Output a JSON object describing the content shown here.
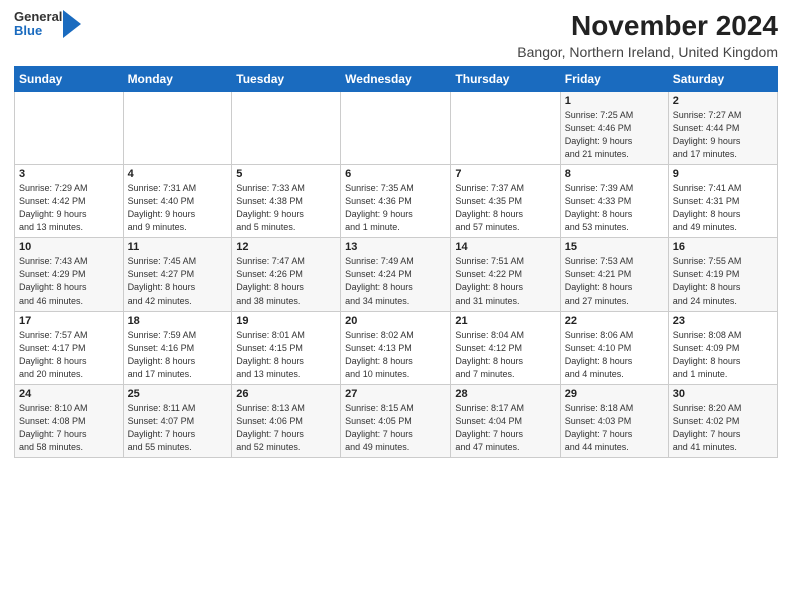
{
  "header": {
    "logo": {
      "general": "General",
      "blue": "Blue"
    },
    "title": "November 2024",
    "subtitle": "Bangor, Northern Ireland, United Kingdom"
  },
  "weekdays": [
    "Sunday",
    "Monday",
    "Tuesday",
    "Wednesday",
    "Thursday",
    "Friday",
    "Saturday"
  ],
  "weeks": [
    [
      {
        "day": "",
        "info": ""
      },
      {
        "day": "",
        "info": ""
      },
      {
        "day": "",
        "info": ""
      },
      {
        "day": "",
        "info": ""
      },
      {
        "day": "",
        "info": ""
      },
      {
        "day": "1",
        "info": "Sunrise: 7:25 AM\nSunset: 4:46 PM\nDaylight: 9 hours\nand 21 minutes."
      },
      {
        "day": "2",
        "info": "Sunrise: 7:27 AM\nSunset: 4:44 PM\nDaylight: 9 hours\nand 17 minutes."
      }
    ],
    [
      {
        "day": "3",
        "info": "Sunrise: 7:29 AM\nSunset: 4:42 PM\nDaylight: 9 hours\nand 13 minutes."
      },
      {
        "day": "4",
        "info": "Sunrise: 7:31 AM\nSunset: 4:40 PM\nDaylight: 9 hours\nand 9 minutes."
      },
      {
        "day": "5",
        "info": "Sunrise: 7:33 AM\nSunset: 4:38 PM\nDaylight: 9 hours\nand 5 minutes."
      },
      {
        "day": "6",
        "info": "Sunrise: 7:35 AM\nSunset: 4:36 PM\nDaylight: 9 hours\nand 1 minute."
      },
      {
        "day": "7",
        "info": "Sunrise: 7:37 AM\nSunset: 4:35 PM\nDaylight: 8 hours\nand 57 minutes."
      },
      {
        "day": "8",
        "info": "Sunrise: 7:39 AM\nSunset: 4:33 PM\nDaylight: 8 hours\nand 53 minutes."
      },
      {
        "day": "9",
        "info": "Sunrise: 7:41 AM\nSunset: 4:31 PM\nDaylight: 8 hours\nand 49 minutes."
      }
    ],
    [
      {
        "day": "10",
        "info": "Sunrise: 7:43 AM\nSunset: 4:29 PM\nDaylight: 8 hours\nand 46 minutes."
      },
      {
        "day": "11",
        "info": "Sunrise: 7:45 AM\nSunset: 4:27 PM\nDaylight: 8 hours\nand 42 minutes."
      },
      {
        "day": "12",
        "info": "Sunrise: 7:47 AM\nSunset: 4:26 PM\nDaylight: 8 hours\nand 38 minutes."
      },
      {
        "day": "13",
        "info": "Sunrise: 7:49 AM\nSunset: 4:24 PM\nDaylight: 8 hours\nand 34 minutes."
      },
      {
        "day": "14",
        "info": "Sunrise: 7:51 AM\nSunset: 4:22 PM\nDaylight: 8 hours\nand 31 minutes."
      },
      {
        "day": "15",
        "info": "Sunrise: 7:53 AM\nSunset: 4:21 PM\nDaylight: 8 hours\nand 27 minutes."
      },
      {
        "day": "16",
        "info": "Sunrise: 7:55 AM\nSunset: 4:19 PM\nDaylight: 8 hours\nand 24 minutes."
      }
    ],
    [
      {
        "day": "17",
        "info": "Sunrise: 7:57 AM\nSunset: 4:17 PM\nDaylight: 8 hours\nand 20 minutes."
      },
      {
        "day": "18",
        "info": "Sunrise: 7:59 AM\nSunset: 4:16 PM\nDaylight: 8 hours\nand 17 minutes."
      },
      {
        "day": "19",
        "info": "Sunrise: 8:01 AM\nSunset: 4:15 PM\nDaylight: 8 hours\nand 13 minutes."
      },
      {
        "day": "20",
        "info": "Sunrise: 8:02 AM\nSunset: 4:13 PM\nDaylight: 8 hours\nand 10 minutes."
      },
      {
        "day": "21",
        "info": "Sunrise: 8:04 AM\nSunset: 4:12 PM\nDaylight: 8 hours\nand 7 minutes."
      },
      {
        "day": "22",
        "info": "Sunrise: 8:06 AM\nSunset: 4:10 PM\nDaylight: 8 hours\nand 4 minutes."
      },
      {
        "day": "23",
        "info": "Sunrise: 8:08 AM\nSunset: 4:09 PM\nDaylight: 8 hours\nand 1 minute."
      }
    ],
    [
      {
        "day": "24",
        "info": "Sunrise: 8:10 AM\nSunset: 4:08 PM\nDaylight: 7 hours\nand 58 minutes."
      },
      {
        "day": "25",
        "info": "Sunrise: 8:11 AM\nSunset: 4:07 PM\nDaylight: 7 hours\nand 55 minutes."
      },
      {
        "day": "26",
        "info": "Sunrise: 8:13 AM\nSunset: 4:06 PM\nDaylight: 7 hours\nand 52 minutes."
      },
      {
        "day": "27",
        "info": "Sunrise: 8:15 AM\nSunset: 4:05 PM\nDaylight: 7 hours\nand 49 minutes."
      },
      {
        "day": "28",
        "info": "Sunrise: 8:17 AM\nSunset: 4:04 PM\nDaylight: 7 hours\nand 47 minutes."
      },
      {
        "day": "29",
        "info": "Sunrise: 8:18 AM\nSunset: 4:03 PM\nDaylight: 7 hours\nand 44 minutes."
      },
      {
        "day": "30",
        "info": "Sunrise: 8:20 AM\nSunset: 4:02 PM\nDaylight: 7 hours\nand 41 minutes."
      }
    ]
  ]
}
